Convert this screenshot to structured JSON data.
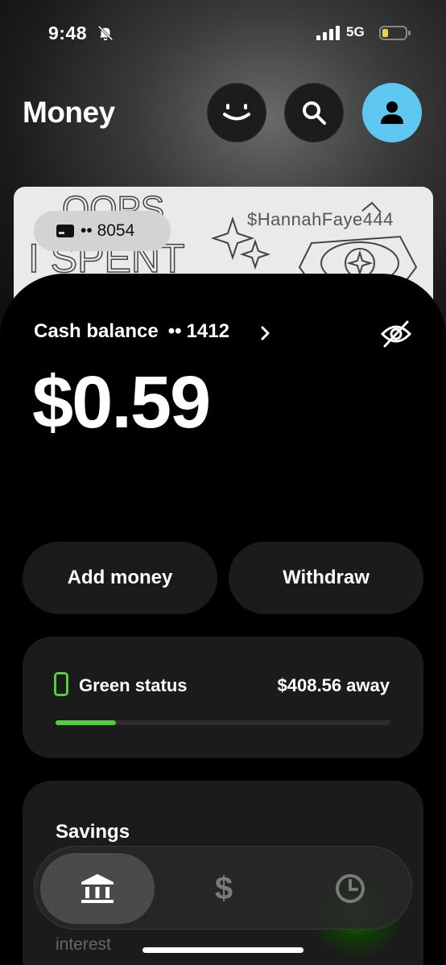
{
  "status_bar": {
    "time": "9:48",
    "network": "5G",
    "icons": [
      "bell-slash-icon",
      "signal-icon",
      "battery-icon"
    ]
  },
  "header": {
    "title": "Money",
    "buttons": [
      "smiley-icon",
      "search-icon",
      "profile-icon"
    ],
    "accent": "#5ec8f0"
  },
  "card": {
    "cashtag": "$HannahFaye444",
    "number_dots": "••",
    "last4": "8054",
    "art_text": [
      "OOPS",
      "I SPENT"
    ]
  },
  "account": {
    "label": "Cash balance",
    "number_dots": "••",
    "last4": "1412",
    "balance": "$0.59"
  },
  "actions": {
    "add_money": "Add money",
    "withdraw": "Withdraw"
  },
  "green_status": {
    "label": "Green status",
    "away": "$408.56 away",
    "progress_fraction": 0.18,
    "color": "#4cd137"
  },
  "savings": {
    "title": "Savings",
    "subtitle": "interest"
  },
  "tab_bar": {
    "tabs": [
      "bank-icon",
      "dollar-icon",
      "clock-icon"
    ],
    "dollar_glyph": "$",
    "active": 0
  }
}
